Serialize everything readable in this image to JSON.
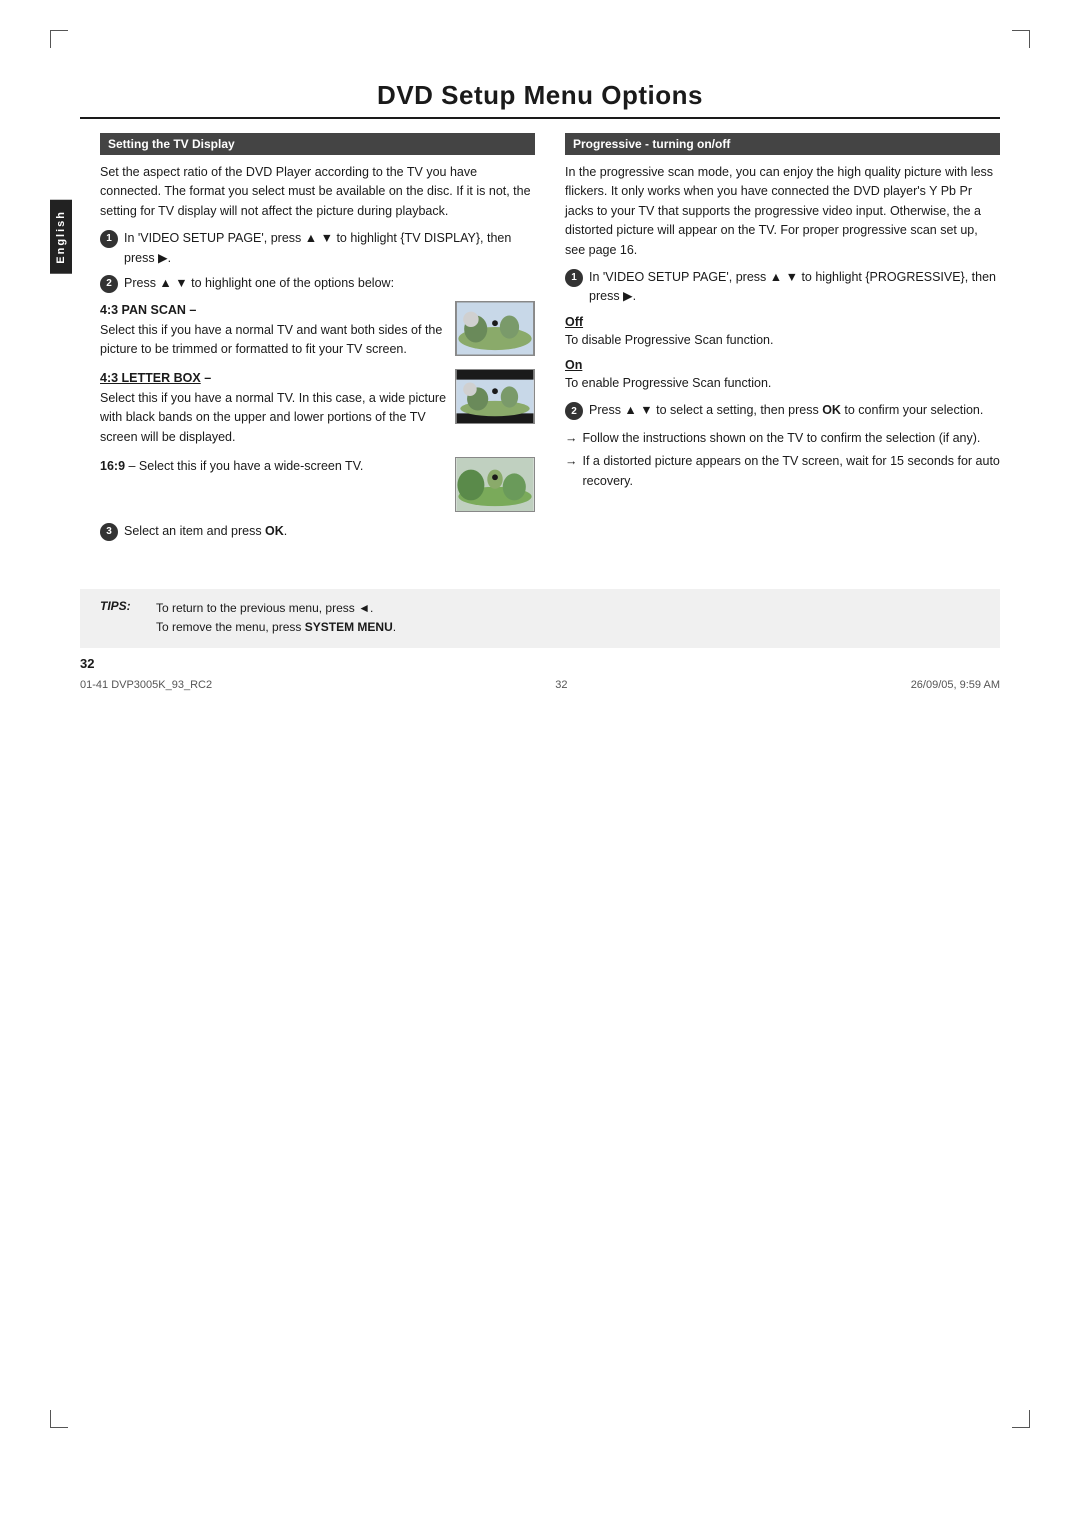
{
  "page": {
    "title": "DVD Setup Menu Options",
    "page_number": "32",
    "footer_left": "01-41  DVP3005K_93_RC2",
    "footer_center": "32",
    "footer_right": "26/09/05, 9:59 AM"
  },
  "sidebar": {
    "label": "English"
  },
  "left_section": {
    "header": "Setting the TV Display",
    "intro": "Set the aspect ratio of the DVD Player according to the TV you have connected. The format you select must be available on the disc. If it is not, the setting for TV display will not affect the picture during playback.",
    "step1": "In 'VIDEO SETUP PAGE', press ▲ ▼ to highlight {TV DISPLAY}, then press ▶.",
    "step2": "Press ▲ ▼ to highlight one of the options below:",
    "option1_title": "4:3 PAN SCAN –",
    "option1_text": "Select this if you have a normal TV and want both sides of the picture to be trimmed or formatted to fit your TV screen.",
    "option2_title": "4:3 LETTER BOX",
    "option2_dash": " –",
    "option2_text": "Select this if you have a normal TV. In this case, a wide picture with black bands on the upper and lower portions of the TV screen will be displayed.",
    "option3_title": "16:9",
    "option3_text": " – Select this if you have a wide-screen TV.",
    "step3": "Select an item and press OK."
  },
  "right_section": {
    "header": "Progressive - turning on/off",
    "intro": "In the progressive scan mode, you can enjoy the high quality picture with less flickers. It only works when you have connected the DVD player's Y Pb Pr jacks to your TV that supports the progressive video input. Otherwise, the a distorted picture will appear on the TV. For proper progressive scan set up, see page 16.",
    "step1": "In 'VIDEO SETUP PAGE', press ▲ ▼ to highlight {PROGRESSIVE}, then press ▶.",
    "off_heading": "Off",
    "off_text": "To disable Progressive Scan function.",
    "on_heading": "On",
    "on_text": "To enable Progressive Scan function.",
    "step2": "Press ▲ ▼ to select a setting, then press OK to confirm your selection.",
    "arrow1": "Follow the instructions shown on the TV to confirm the selection (if any).",
    "arrow2": "If a distorted picture appears on the TV screen, wait for 15 seconds for auto recovery."
  },
  "tips": {
    "label": "TIPS:",
    "line1": "To return to the previous menu, press ◄.",
    "line2": "To remove the menu, press SYSTEM MENU."
  }
}
